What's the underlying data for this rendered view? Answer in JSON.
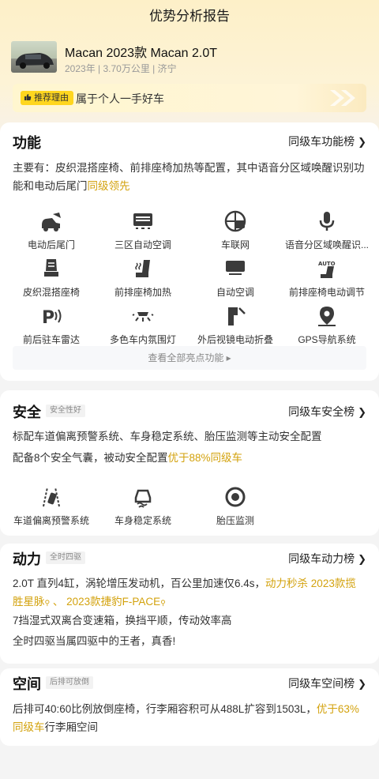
{
  "header": {
    "title": "优势分析报告"
  },
  "car": {
    "title": "Macan 2023款 Macan 2.0T",
    "meta": "2023年 | 3.70万公里 | 济宁"
  },
  "reason": {
    "tag": "推荐理由",
    "text": "属于个人一手好车"
  },
  "features": {
    "title": "功能",
    "link": "同级车功能榜",
    "desc_prefix": "主要有：皮织混搭座椅、前排座椅加热等配置，其中语音分区域唤醒识别功能和电动后尾门",
    "desc_highlight": "同级领先",
    "items": [
      {
        "label": "电动后尾门",
        "icon": "power-tailgate-icon"
      },
      {
        "label": "三区自动空调",
        "icon": "tri-zone-ac-icon"
      },
      {
        "label": "车联网",
        "icon": "connected-car-icon"
      },
      {
        "label": "语音分区域唤醒识...",
        "icon": "voice-microphone-icon"
      },
      {
        "label": "皮织混搭座椅",
        "icon": "leather-seat-icon"
      },
      {
        "label": "前排座椅加热",
        "icon": "seat-heating-icon"
      },
      {
        "label": "自动空调",
        "icon": "auto-ac-icon"
      },
      {
        "label": "前排座椅电动调节",
        "icon": "seat-power-adjust-icon"
      },
      {
        "label": "前后驻车雷达",
        "icon": "parking-radar-icon"
      },
      {
        "label": "多色车内氛围灯",
        "icon": "ambient-light-icon"
      },
      {
        "label": "外后视镜电动折叠",
        "icon": "mirror-fold-icon"
      },
      {
        "label": "GPS导航系统",
        "icon": "gps-navigation-icon"
      }
    ],
    "see_all": "查看全部亮点功能 ▸"
  },
  "safety": {
    "title": "安全",
    "badge": "安全性好",
    "link": "同级车安全榜",
    "line1": "标配车道偏离预警系统、车身稳定系统、胎压监测等主动安全配置",
    "line2_prefix": "配备8个安全气囊，被动安全配置",
    "line2_highlight": "优于88%同级车",
    "items": [
      {
        "label": "车道偏离预警系统",
        "icon": "lane-departure-icon"
      },
      {
        "label": "车身稳定系统",
        "icon": "stability-control-icon"
      },
      {
        "label": "胎压监测",
        "icon": "tire-pressure-icon"
      }
    ]
  },
  "power": {
    "title": "动力",
    "badge": "全时四驱",
    "link": "同级车动力榜",
    "line1_prefix": "2.0T 直列4缸，涡轮增压发动机，百公里加速仅6.4s，",
    "line1_highlight": "动力秒杀 2023款揽胜星脉",
    "line1_sep": " 、 ",
    "line1_highlight2": "2023款捷豹F-PACE",
    "line2": "7挡湿式双离合变速箱，换挡平顺，传动效率高",
    "line3": "全时四驱当属四驱中的王者，真香!"
  },
  "space": {
    "title": "空间",
    "badge": "后排可放倒",
    "link": "同级车空间榜",
    "line_prefix": "后排可40:60比例放倒座椅，行李厢容积可从488L扩容到1503L，",
    "line_highlight": "优于63%同级车",
    "line_suffix": "行李厢空间"
  },
  "colors": {
    "accent": "#d3a20d",
    "badge_yellow": "#ffd61f"
  }
}
